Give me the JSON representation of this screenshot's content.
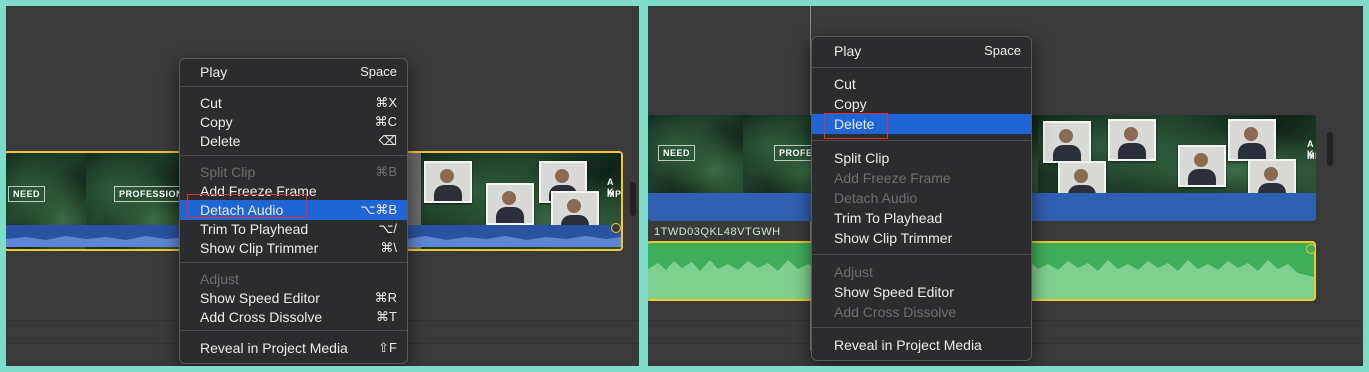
{
  "left": {
    "clip_labels": [
      "NEED",
      "PROFESSIONAL",
      "A K",
      "MPR"
    ],
    "menu": {
      "items": [
        {
          "label": "Play",
          "shortcut": "Space",
          "enabled": true
        },
        {
          "label": "Cut",
          "shortcut": "⌘X",
          "enabled": true
        },
        {
          "label": "Copy",
          "shortcut": "⌘C",
          "enabled": true
        },
        {
          "label": "Delete",
          "shortcut": "⌫",
          "enabled": true
        },
        {
          "label": "Split Clip",
          "shortcut": "⌘B",
          "enabled": false
        },
        {
          "label": "Add Freeze Frame",
          "shortcut": "",
          "enabled": true
        },
        {
          "label": "Detach Audio",
          "shortcut": "⌥⌘B",
          "enabled": true,
          "highlighted": true
        },
        {
          "label": "Trim To Playhead",
          "shortcut": "⌥/",
          "enabled": true
        },
        {
          "label": "Show Clip Trimmer",
          "shortcut": "⌘\\",
          "enabled": true
        },
        {
          "label": "Adjust",
          "shortcut": "",
          "enabled": false
        },
        {
          "label": "Show Speed Editor",
          "shortcut": "⌘R",
          "enabled": true
        },
        {
          "label": "Add Cross Dissolve",
          "shortcut": "⌘T",
          "enabled": true
        },
        {
          "label": "Reveal in Project Media",
          "shortcut": "⇧F",
          "enabled": true
        }
      ]
    }
  },
  "right": {
    "clip_labels": [
      "NEED",
      "PROFE",
      "A K",
      "MPRI"
    ],
    "audio_clip_name": "1TWD03QKL48VTGWH",
    "menu": {
      "items": [
        {
          "label": "Play",
          "shortcut": "Space",
          "enabled": true
        },
        {
          "label": "Cut",
          "shortcut": "",
          "enabled": true
        },
        {
          "label": "Copy",
          "shortcut": "",
          "enabled": true
        },
        {
          "label": "Delete",
          "shortcut": "",
          "enabled": true,
          "highlighted": true
        },
        {
          "label": "Split Clip",
          "shortcut": "",
          "enabled": true
        },
        {
          "label": "Add Freeze Frame",
          "shortcut": "",
          "enabled": false
        },
        {
          "label": "Detach Audio",
          "shortcut": "",
          "enabled": false
        },
        {
          "label": "Trim To Playhead",
          "shortcut": "",
          "enabled": true
        },
        {
          "label": "Show Clip Trimmer",
          "shortcut": "",
          "enabled": true
        },
        {
          "label": "Adjust",
          "shortcut": "",
          "enabled": false
        },
        {
          "label": "Show Speed Editor",
          "shortcut": "",
          "enabled": true
        },
        {
          "label": "Add Cross Dissolve",
          "shortcut": "",
          "enabled": false
        },
        {
          "label": "Reveal in Project Media",
          "shortcut": "",
          "enabled": true
        }
      ]
    }
  },
  "colors": {
    "highlight": "#1f65d6",
    "selection_border": "#f2c830",
    "audio_green": "#3fae5a",
    "video_blue": "#2f5fb0",
    "annotation_red": "#e0303a"
  }
}
